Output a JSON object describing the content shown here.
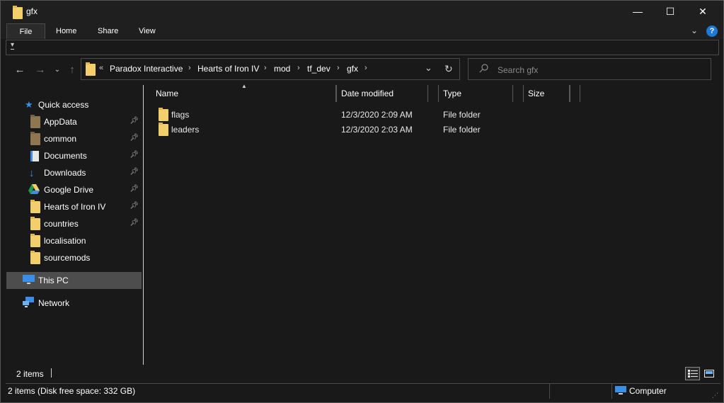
{
  "window": {
    "title": "gfx"
  },
  "titlebar_buttons": {
    "minimize": "—",
    "maximize": "☐",
    "close": "✕"
  },
  "ribbon": {
    "tabs": [
      {
        "label": "File",
        "active": true
      },
      {
        "label": "Home"
      },
      {
        "label": "Share"
      },
      {
        "label": "View"
      }
    ]
  },
  "address": {
    "overflow": "«",
    "crumbs": [
      "Paradox Interactive",
      "Hearts of Iron IV",
      "mod",
      "tf_dev",
      "gfx"
    ]
  },
  "search": {
    "placeholder": "Search gfx"
  },
  "nav": {
    "quick_access": "Quick access",
    "items": [
      {
        "label": "AppData",
        "pinned": true,
        "icon": "folder-dark-icon"
      },
      {
        "label": "common",
        "pinned": true,
        "icon": "folder-dark-icon"
      },
      {
        "label": "Documents",
        "pinned": true,
        "icon": "documents-icon"
      },
      {
        "label": "Downloads",
        "pinned": true,
        "icon": "download-icon"
      },
      {
        "label": "Google Drive",
        "pinned": true,
        "icon": "google-drive-icon"
      },
      {
        "label": "Hearts of Iron IV",
        "pinned": true,
        "icon": "folder-icon"
      },
      {
        "label": "countries",
        "pinned": true,
        "icon": "folder-icon"
      },
      {
        "label": "localisation",
        "pinned": false,
        "icon": "folder-icon"
      },
      {
        "label": "sourcemods",
        "pinned": false,
        "icon": "folder-icon"
      }
    ],
    "this_pc": "This PC",
    "network": "Network"
  },
  "columns": {
    "name": "Name",
    "date": "Date modified",
    "type": "Type",
    "size": "Size"
  },
  "files": [
    {
      "name": "flags",
      "date": "12/3/2020 2:09 AM",
      "type": "File folder",
      "size": ""
    },
    {
      "name": "leaders",
      "date": "12/3/2020 2:03 AM",
      "type": "File folder",
      "size": ""
    }
  ],
  "status": {
    "items": "2 items",
    "free_space": "2 items (Disk free space: 332 GB)",
    "location": "Computer"
  },
  "colors": {
    "background": "#191919",
    "folder": "#f3cf6b",
    "accent": "#1e78d6",
    "selected": "#4d4d4d"
  }
}
